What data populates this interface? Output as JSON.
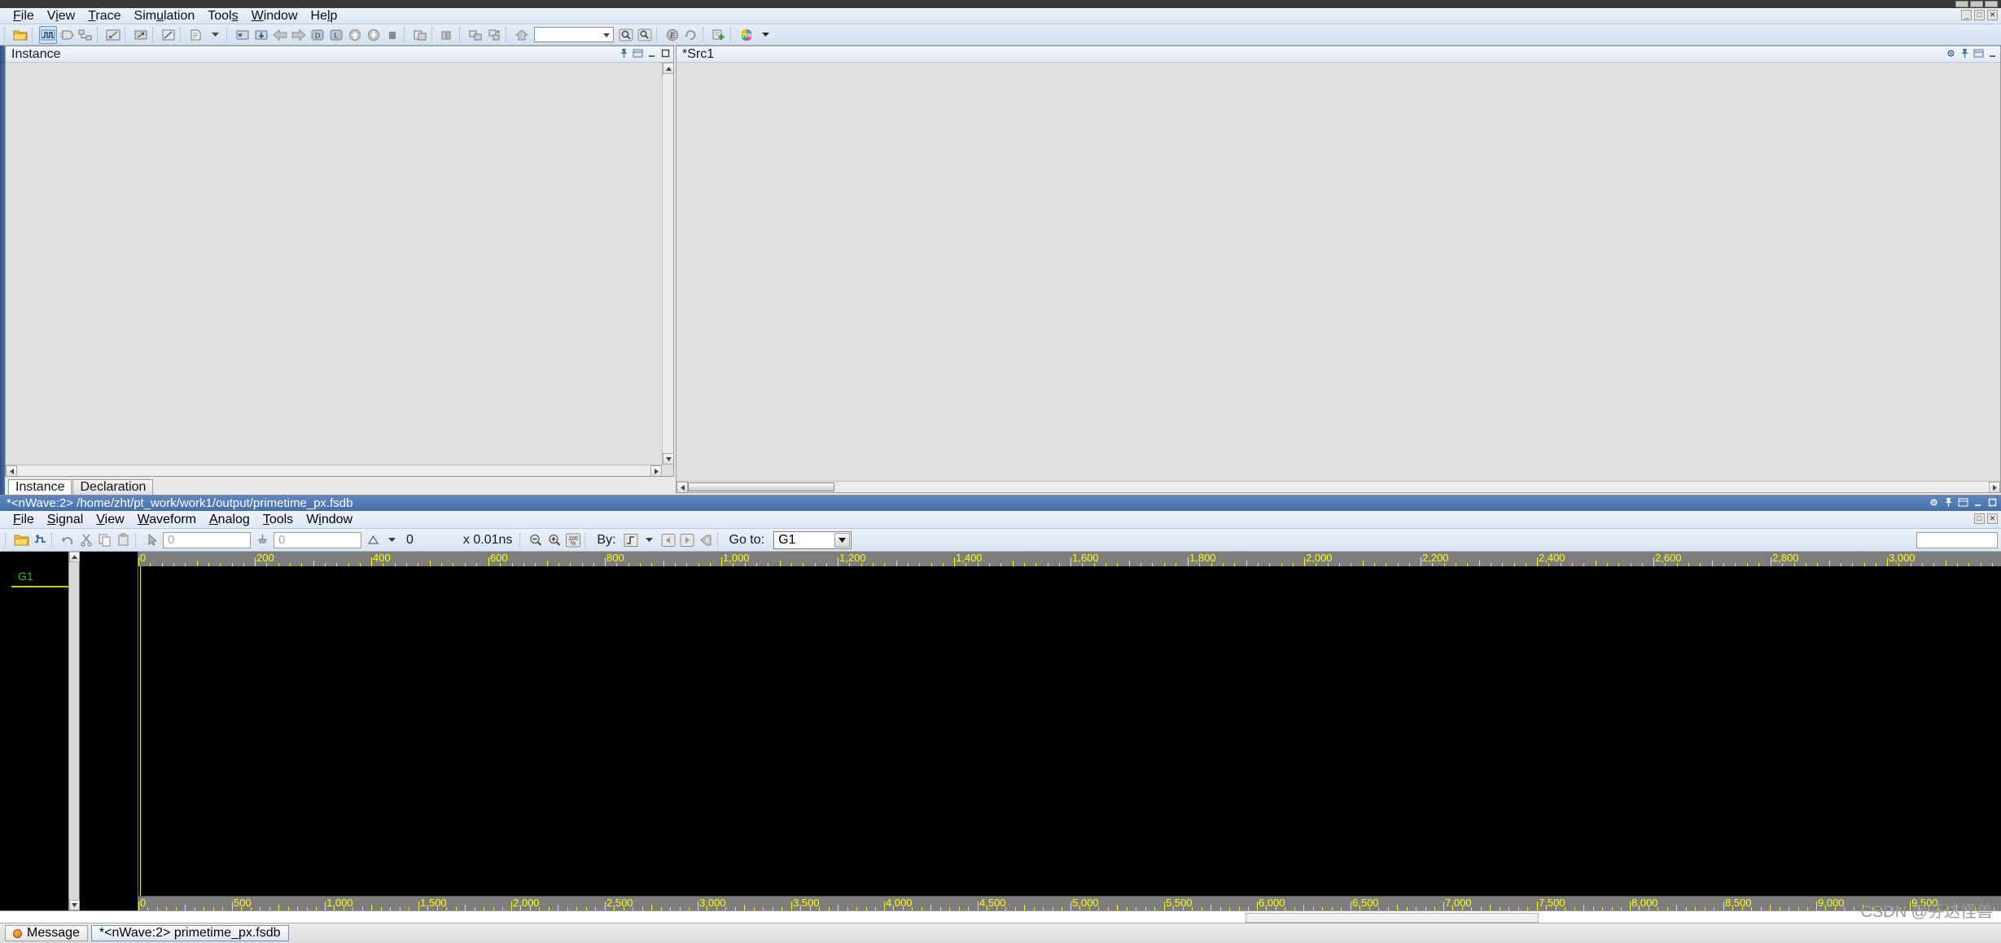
{
  "window": {
    "title": "",
    "sys_buttons": [
      "minimize",
      "maximize",
      "close"
    ]
  },
  "menubar": {
    "items": [
      {
        "label": "File",
        "accel": "F"
      },
      {
        "label": "View",
        "accel": "V"
      },
      {
        "label": "Trace",
        "accel": "T"
      },
      {
        "label": "Simulation",
        "accel": "u"
      },
      {
        "label": "Tools",
        "accel": "s"
      },
      {
        "label": "Window",
        "accel": "W"
      },
      {
        "label": "Help",
        "accel": "l"
      }
    ],
    "window_buttons": [
      "_",
      "□",
      "×"
    ]
  },
  "toolbar": {
    "icons": [
      "open-folder-icon",
      "waveform-icon",
      "schematic-icon",
      "hierarchy-icon",
      "fsm-icon",
      "flow-icon",
      "temporal-icon",
      "report-icon",
      "transaction-icon",
      "source-icon",
      "back-arrow-icon",
      "forward-arrow-icon",
      "debug-icon",
      "log-icon",
      "up-arrow-icon",
      "down-arrow-icon",
      "stop-icon",
      "copy-window-icon",
      "books-icon",
      "expand-icon",
      "collapse-icon",
      "home-icon"
    ],
    "search_combo_value": "",
    "search_combo_placeholder": "",
    "right_icons": [
      "search-icon",
      "find-next-icon",
      "evaluate-icon",
      "refresh-icon",
      "add-signal-icon",
      "uvm-icon",
      "chevron-down-icon"
    ]
  },
  "instance_panel": {
    "title": "Instance",
    "header_buttons": [
      "pin-icon",
      "undock-icon",
      "minimize-icon",
      "maximize-icon"
    ],
    "tabs": [
      {
        "label": "Instance",
        "active": true
      },
      {
        "label": "Declaration",
        "active": false
      }
    ],
    "content": ""
  },
  "source_panel": {
    "title": "*Src1",
    "header_buttons": [
      "gear-icon",
      "pin-icon",
      "undock-icon",
      "minimize-icon"
    ],
    "content": ""
  },
  "nwave": {
    "title": "*<nWave:2> /home/zht/pt_work/work1/output/primetime_px.fsdb",
    "title_buttons": [
      "gear-icon",
      "pin-icon",
      "undock-icon",
      "minimize-icon",
      "maximize-icon"
    ],
    "menubar": {
      "items": [
        {
          "label": "File",
          "accel": "F"
        },
        {
          "label": "Signal",
          "accel": "S"
        },
        {
          "label": "View",
          "accel": "V"
        },
        {
          "label": "Waveform",
          "accel": "W"
        },
        {
          "label": "Analog",
          "accel": "A"
        },
        {
          "label": "Tools",
          "accel": "T"
        },
        {
          "label": "Window",
          "accel": "i"
        }
      ]
    },
    "toolbar": {
      "icons": [
        "open-folder-icon",
        "reload-icon",
        "undo-icon",
        "cut-icon",
        "copy-icon",
        "paste-icon",
        "pointer-icon"
      ],
      "time_field_1": {
        "value": "",
        "placeholder": "0"
      },
      "time_field_2": {
        "value": "",
        "placeholder": "0"
      },
      "delta_label": "0",
      "delta_icon": "triangle-icon",
      "scale_label": "x 0.01ns",
      "zoom_out_icon": "zoom-out-icon",
      "zoom_in_icon": "zoom-in-icon",
      "zoom_fit_label": "100%",
      "by_label": "By:",
      "by_icon": "edge-icon",
      "prev_icon": "prev-arrow-icon",
      "next_icon": "next-arrow-icon",
      "any_icon": "any-edge-icon",
      "goto_label": "Go to:",
      "goto_value": "G1",
      "goto_options": [
        "G1"
      ]
    },
    "signal_pane": {
      "marker_name": "G1"
    },
    "ruler_top": {
      "unit_step": 200,
      "labels": [
        "0",
        "200",
        "400",
        "600",
        "800",
        "1,000",
        "1,200",
        "1,400",
        "1,600",
        "1,800",
        "2,000",
        "2,200",
        "2,400",
        "2,600",
        "2,800",
        "3,000"
      ]
    },
    "ruler_bottom": {
      "unit_step": 500,
      "labels": [
        "0",
        "500",
        "1,000",
        "1,500",
        "2,000",
        "2,500",
        "3,000",
        "3,500",
        "4,000",
        "4,500",
        "5,000",
        "5,500",
        "6,000",
        "6,500",
        "7,000",
        "7,500",
        "8,000",
        "8,500",
        "9,000",
        "9,500"
      ]
    },
    "waveform_background": "#000000",
    "tick_color": "#ffff00",
    "marker_color": "#00d000"
  },
  "statusbar": {
    "tabs": [
      {
        "label": "Message",
        "icon": "message-icon",
        "active": false
      },
      {
        "label": "*<nWave:2> primetime_px.fsdb",
        "icon": "",
        "active": true
      }
    ]
  },
  "watermark": {
    "text": "CSDN @芬达怪兽"
  }
}
